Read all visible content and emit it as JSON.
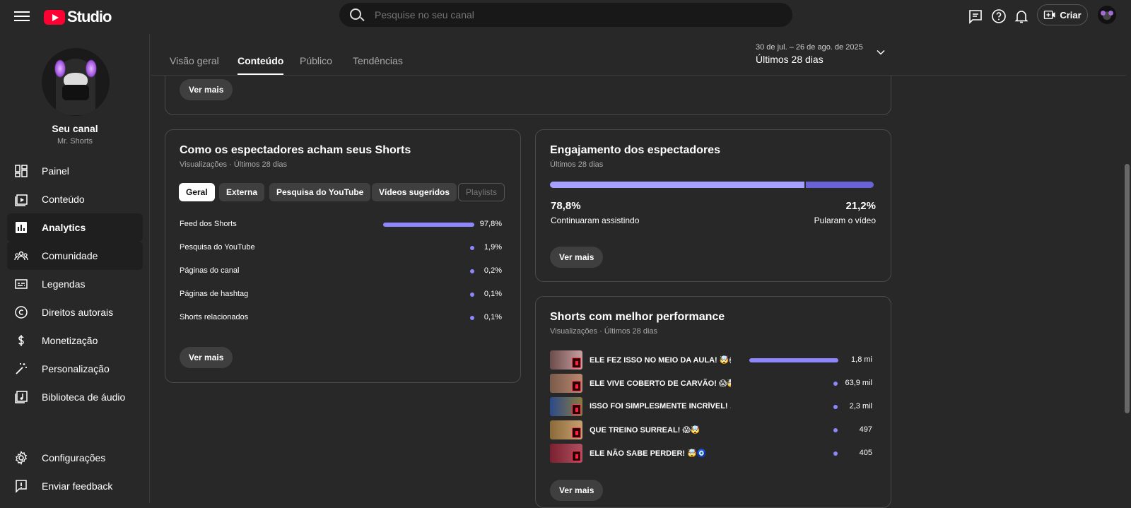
{
  "app": {
    "logo_text": "Studio"
  },
  "search": {
    "placeholder": "Pesquise no seu canal"
  },
  "header": {
    "create_label": "Criar"
  },
  "channel": {
    "title": "Seu canal",
    "handle": "Mr. Shorts"
  },
  "nav": {
    "items": [
      {
        "label": "Painel",
        "icon": "dashboard-icon"
      },
      {
        "label": "Conteúdo",
        "icon": "content-icon"
      },
      {
        "label": "Analytics",
        "icon": "analytics-icon"
      },
      {
        "label": "Comunidade",
        "icon": "community-icon"
      },
      {
        "label": "Legendas",
        "icon": "subtitles-icon"
      },
      {
        "label": "Direitos autorais",
        "icon": "copyright-icon"
      },
      {
        "label": "Monetização",
        "icon": "dollar-icon"
      },
      {
        "label": "Personalização",
        "icon": "magic-wand-icon"
      },
      {
        "label": "Biblioteca de áudio",
        "icon": "audio-library-icon"
      }
    ],
    "bottom": [
      {
        "label": "Configurações",
        "icon": "gear-icon"
      },
      {
        "label": "Enviar feedback",
        "icon": "feedback-icon"
      }
    ]
  },
  "tabs": [
    {
      "label": "Visão geral"
    },
    {
      "label": "Conteúdo"
    },
    {
      "label": "Público"
    },
    {
      "label": "Tendências"
    }
  ],
  "date_range": {
    "range": "30 de jul. – 26 de ago. de 2025",
    "label": "Últimos 28 dias"
  },
  "top_card": {
    "button": "Ver mais"
  },
  "discovery_card": {
    "title": "Como os espectadores acham seus Shorts",
    "subtitle": "Visualizações · Últimos 28 dias",
    "chips": [
      "Geral",
      "Externa",
      "Pesquisa do YouTube",
      "Vídeos sugeridos",
      "Playlists"
    ],
    "rows": [
      {
        "label": "Feed dos Shorts",
        "value": "97,8%",
        "share": 97.8
      },
      {
        "label": "Pesquisa do YouTube",
        "value": "1,9%",
        "share": 1.9
      },
      {
        "label": "Páginas do canal",
        "value": "0,2%",
        "share": 0.2
      },
      {
        "label": "Páginas de hashtag",
        "value": "0,1%",
        "share": 0.1
      },
      {
        "label": "Shorts relacionados",
        "value": "0,1%",
        "share": 0.1
      }
    ],
    "button": "Ver mais"
  },
  "engagement_card": {
    "title": "Engajamento dos espectadores",
    "subtitle": "Últimos 28 dias",
    "kept_value": "78,8%",
    "kept_label": "Continuaram assistindo",
    "swiped_value": "21,2%",
    "swiped_label": "Pularam o vídeo",
    "colors": {
      "kept": "#a5a0ff",
      "swiped": "#6a63d8"
    },
    "button": "Ver mais"
  },
  "top_shorts_card": {
    "title": "Shorts com melhor performance",
    "subtitle": "Visualizações · Últimos 28 dias",
    "rows": [
      {
        "title": "ELE FEZ ISSO NO MEIO DA AULA! 🤯😱",
        "value": "1,8 mi"
      },
      {
        "title": "ELE VIVE COBERTO DE CARVÃO! 😱🤯",
        "value": "63,9 mil"
      },
      {
        "title": "ISSO FOI SIMPLESMENTE INCRÍVEL! …",
        "value": "2,3 mil"
      },
      {
        "title": "QUE TREINO SURREAL! 😱🤯",
        "value": "497"
      },
      {
        "title": "ELE NÃO SABE PERDER! 🤯🧿",
        "value": "405"
      }
    ],
    "button": "Ver mais"
  },
  "colors": {
    "accent": "#8c86ff",
    "background": "#282828",
    "youtube_red": "#ff0033"
  }
}
